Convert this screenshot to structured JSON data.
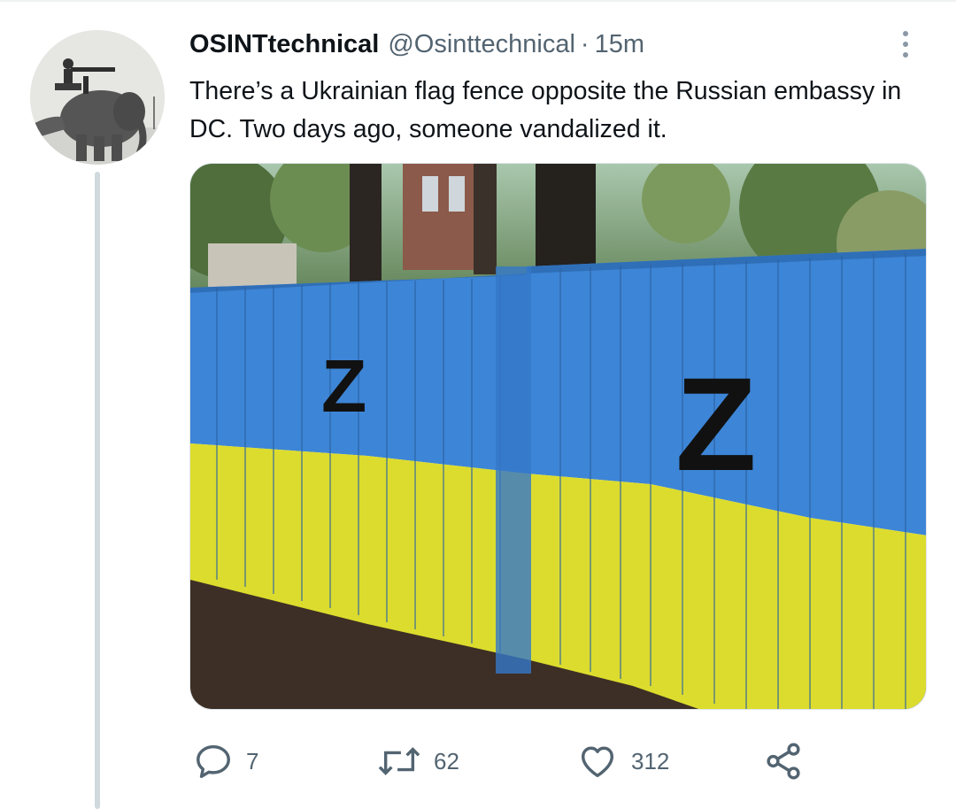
{
  "tweet": {
    "display_name": "OSINTtechnical",
    "handle": "@Osinttechnical",
    "separator": "·",
    "time": "15m",
    "text": "There’s a Ukrainian flag fence opposite the Russian embassy in DC. Two days ago, someone vandalized it.",
    "media_graffiti": [
      "Z",
      "Z"
    ],
    "actions": {
      "reply_count": "7",
      "retweet_count": "62",
      "like_count": "312"
    }
  },
  "colors": {
    "fence_blue": "#3d85d6",
    "fence_yellow": "#dcdc2e",
    "secondary_text": "#536471",
    "thread_line": "#cfd9de"
  },
  "icons": [
    "reply-icon",
    "retweet-icon",
    "like-icon",
    "share-icon",
    "more-options-icon"
  ]
}
